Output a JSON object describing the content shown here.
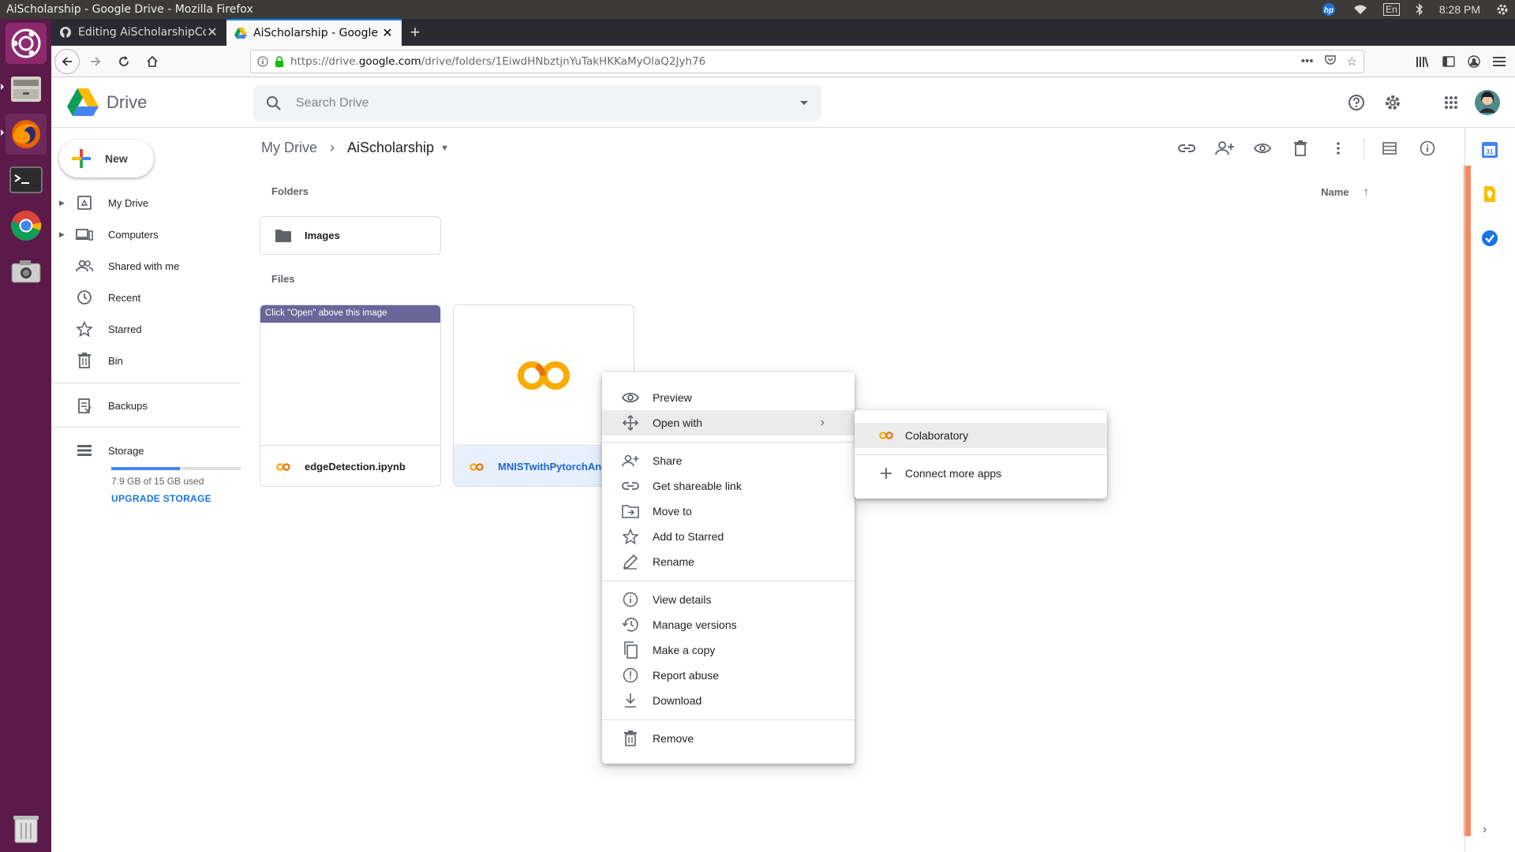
{
  "os_bar": {
    "window_title": "AiScholarship - Google Drive - Mozilla Firefox",
    "keyboard": "En",
    "time": "8:28 PM"
  },
  "launcher": {
    "items": [
      "ubuntu-dash",
      "files",
      "firefox",
      "terminal",
      "chrome",
      "screenshot",
      "trash"
    ]
  },
  "browser": {
    "tabs": [
      {
        "label": "Editing AiScholarshipCo",
        "favicon": "github-icon"
      },
      {
        "label": "AiScholarship - Google D",
        "favicon": "drive-icon",
        "active": true
      }
    ],
    "url_prefix": "https://drive.",
    "url_domain": "google.com",
    "url_path": "/drive/folders/1EiwdHNbztjnYuTakHKKaMyOlaQ2Jyh76"
  },
  "drive": {
    "logo_text": "Drive",
    "search_placeholder": "Search Drive",
    "new_label": "New",
    "sidebar": {
      "items": [
        {
          "label": "My Drive",
          "icon": "my-drive-icon"
        },
        {
          "label": "Computers",
          "icon": "computers-icon"
        },
        {
          "label": "Shared with me",
          "icon": "shared-icon"
        },
        {
          "label": "Recent",
          "icon": "clock-icon"
        },
        {
          "label": "Starred",
          "icon": "star-icon"
        },
        {
          "label": "Bin",
          "icon": "bin-icon"
        },
        {
          "label": "Backups",
          "icon": "backups-icon"
        },
        {
          "label": "Storage",
          "icon": "storage-icon"
        }
      ],
      "storage_used_fraction": 0.53,
      "storage_text": "7.9 GB of 15 GB used",
      "upgrade_label": "UPGRADE STORAGE"
    },
    "breadcrumb": {
      "root": "My Drive",
      "current": "AiScholarship"
    },
    "folders_label": "Folders",
    "files_label": "Files",
    "sort_label": "Name",
    "folders": [
      {
        "name": "Images"
      }
    ],
    "files": [
      {
        "name": "edgeDetection.ipynb",
        "banner": "Click \"Open\" above this image"
      },
      {
        "name": "MNISTwithPytorchAnd",
        "selected": true
      }
    ]
  },
  "context_menu": {
    "items": [
      {
        "label": "Preview",
        "icon": "eye-icon"
      },
      {
        "label": "Open with",
        "icon": "open-with-icon",
        "has_submenu": true
      },
      {
        "label": "Share",
        "icon": "share-icon"
      },
      {
        "label": "Get shareable link",
        "icon": "link-icon"
      },
      {
        "label": "Move to",
        "icon": "move-to-icon"
      },
      {
        "label": "Add to Starred",
        "icon": "star-icon"
      },
      {
        "label": "Rename",
        "icon": "pencil-icon"
      },
      {
        "label": "View details",
        "icon": "info-icon"
      },
      {
        "label": "Manage versions",
        "icon": "history-icon"
      },
      {
        "label": "Make a copy",
        "icon": "copy-icon"
      },
      {
        "label": "Report abuse",
        "icon": "report-icon"
      },
      {
        "label": "Download",
        "icon": "download-icon"
      },
      {
        "label": "Remove",
        "icon": "trash-icon"
      }
    ],
    "submenu": [
      {
        "label": "Colaboratory",
        "icon": "colab-icon"
      },
      {
        "label": "Connect more apps",
        "icon": "plus-icon"
      }
    ]
  },
  "colors": {
    "launcher_bg": "#5b1a4a",
    "accent_blue": "#1a73e8",
    "colab_orange": "#f9ab00",
    "scroll_accent": "#f28b5e"
  }
}
